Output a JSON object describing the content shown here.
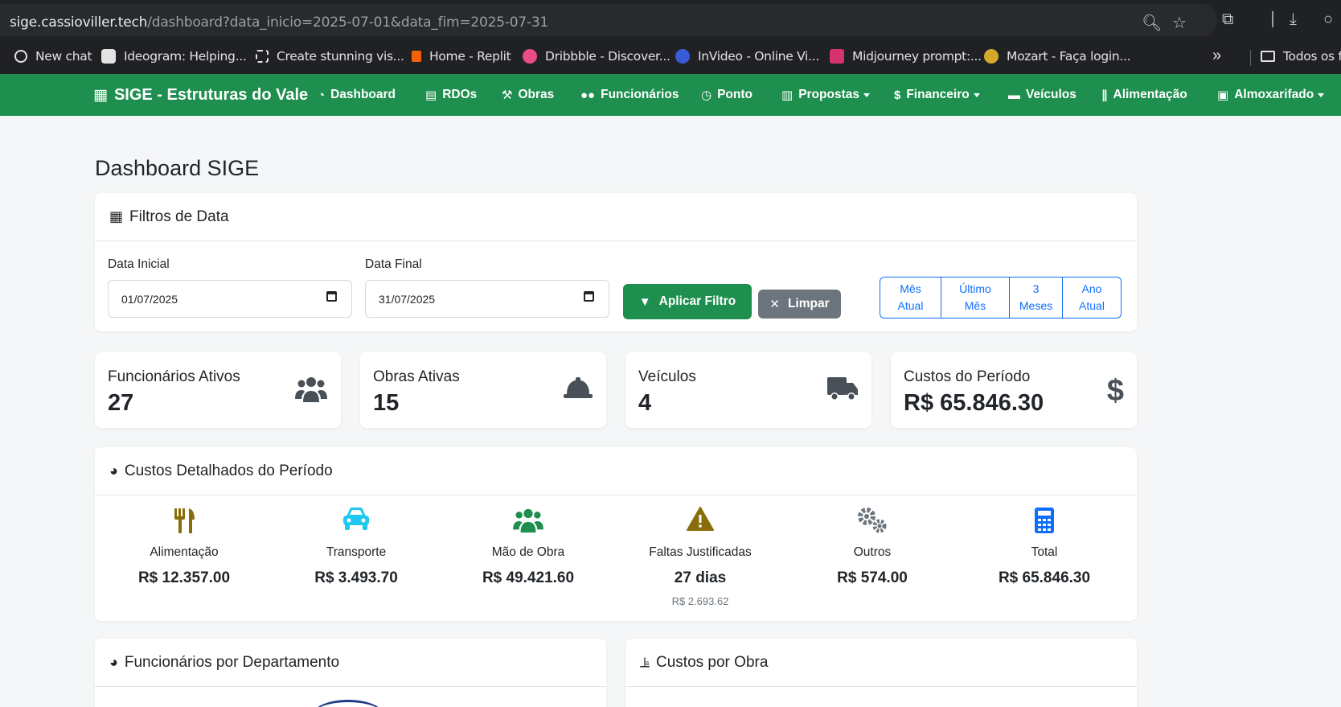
{
  "browser": {
    "url_host": "sige.cassioviller.tech",
    "url_path": "/dashboard?data_inicio=2025-07-01&data_fim=2025-07-31",
    "bookmarks": [
      {
        "label": "New chat",
        "icon": "openai-icon",
        "color": "#e3e3e3"
      },
      {
        "label": "Ideogram: Helping...",
        "icon": "ideogram-icon",
        "color": "#e3e3e3"
      },
      {
        "label": "Create stunning vis...",
        "icon": "frame-icon",
        "color": "#e3e3e3"
      },
      {
        "label": "Home - Replit",
        "icon": "replit-icon",
        "color": "#f26207"
      },
      {
        "label": "Dribbble - Discover...",
        "icon": "dribbble-icon",
        "color": "#ea4c89"
      },
      {
        "label": "InVideo - Online Vi...",
        "icon": "invideo-icon",
        "color": "#3a5bd9"
      },
      {
        "label": "Midjourney prompt:...",
        "icon": "midjourney-icon",
        "color": "#d6336c"
      },
      {
        "label": "Mozart - Faça login...",
        "icon": "mozart-icon",
        "color": "#d4a82b"
      }
    ],
    "bookmarks_folder": "Todos os fa"
  },
  "navbar": {
    "brand": "SIGE - Estruturas do Vale",
    "brand_color": "#1e8f4e",
    "items": [
      {
        "label": "Dashboard",
        "icon": "gauge-icon"
      },
      {
        "label": "RDOs",
        "icon": "clipboard-icon"
      },
      {
        "label": "Obras",
        "icon": "hammer-icon"
      },
      {
        "label": "Funcionários",
        "icon": "users-icon"
      },
      {
        "label": "Ponto",
        "icon": "clock-icon"
      },
      {
        "label": "Propostas",
        "icon": "file-icon",
        "dropdown": true
      },
      {
        "label": "Financeiro",
        "icon": "dollar-icon",
        "dropdown": true
      },
      {
        "label": "Veículos",
        "icon": "car-icon"
      },
      {
        "label": "Alimentação",
        "icon": "utensils-icon"
      },
      {
        "label": "Almoxarifado",
        "icon": "boxes-icon",
        "dropdown": true
      }
    ]
  },
  "page": {
    "title": "Dashboard SIGE"
  },
  "filters": {
    "title": "Filtros de Data",
    "start_label": "Data Inicial",
    "start_value": "01/07/2025",
    "end_label": "Data Final",
    "end_value": "31/07/2025",
    "apply_label": "Aplicar Filtro",
    "clear_label": "Limpar",
    "quick": [
      {
        "line1": "Mês",
        "line2": "Atual"
      },
      {
        "line1": "Último",
        "line2": "Mês"
      },
      {
        "line1": "3",
        "line2": "Meses"
      },
      {
        "line1": "Ano",
        "line2": "Atual"
      }
    ]
  },
  "stats": [
    {
      "title": "Funcionários Ativos",
      "value": "27",
      "icon": "users-icon"
    },
    {
      "title": "Obras Ativas",
      "value": "15",
      "icon": "hard-hat-icon"
    },
    {
      "title": "Veículos",
      "value": "4",
      "icon": "truck-icon"
    },
    {
      "title": "Custos do Período",
      "value": "R$ 65.846.30",
      "icon": "dollar-icon"
    }
  ],
  "costs": {
    "title": "Custos Detalhados do Período",
    "items": [
      {
        "label": "Alimentação",
        "value": "R$ 12.357.00",
        "icon": "utensils-icon",
        "color": "#8a6d0b"
      },
      {
        "label": "Transporte",
        "value": "R$ 3.493.70",
        "icon": "car-icon",
        "color": "#1ec8ee"
      },
      {
        "label": "Mão de Obra",
        "value": "R$ 49.421.60",
        "icon": "users-icon",
        "color": "#1e8f4e"
      },
      {
        "label": "Faltas Justificadas",
        "value": "27 dias",
        "sub": "R$ 2.693.62",
        "icon": "warning-icon",
        "color": "#8a6d0b"
      },
      {
        "label": "Outros",
        "value": "R$ 574.00",
        "icon": "gears-icon",
        "color": "#6c757d"
      },
      {
        "label": "Total",
        "value": "R$ 65.846.30",
        "icon": "calculator-icon",
        "color": "#0d6efd"
      }
    ]
  },
  "bottom_cards": {
    "left_title": "Funcionários por Departamento",
    "right_title": "Custos por Obra"
  }
}
